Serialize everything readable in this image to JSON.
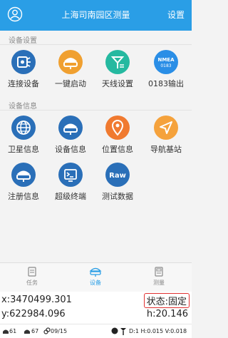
{
  "header": {
    "title": "上海司南园区测量",
    "settings_label": "设置",
    "color": "#2a9ee6"
  },
  "sections": {
    "device_settings": "设备设置",
    "device_info": "设备信息"
  },
  "tiles": [
    {
      "label": "连接设备",
      "icon": "connect-device-icon",
      "color": "#2a6fb8"
    },
    {
      "label": "一键启动",
      "icon": "one-key-start-icon",
      "color": "#f0a030"
    },
    {
      "label": "天线设置",
      "icon": "antenna-icon",
      "color": "#25b9a0"
    },
    {
      "label": "0183输出",
      "icon": "nmea-icon",
      "color": "#2a8ee6",
      "badge_top": "NMEA",
      "badge_bottom": "0183"
    },
    {
      "label": "卫星信息",
      "icon": "satellite-globe-icon",
      "color": "#2a6fb8"
    },
    {
      "label": "设备信息",
      "icon": "device-info-icon",
      "color": "#2a6fb8"
    },
    {
      "label": "位置信息",
      "icon": "location-pin-icon",
      "color": "#f07a30"
    },
    {
      "label": "导航基站",
      "icon": "navigation-arrow-icon",
      "color": "#f5a23c"
    },
    {
      "label": "注册信息",
      "icon": "register-info-icon",
      "color": "#2a6fb8"
    },
    {
      "label": "超级终端",
      "icon": "terminal-icon",
      "color": "#2a6fb8"
    },
    {
      "label": "测试数据",
      "icon": "raw-data-icon",
      "color": "#2a6fb8",
      "badge": "Raw"
    }
  ],
  "tabs": [
    {
      "label": "任务",
      "icon": "task-icon",
      "active": false
    },
    {
      "label": "设备",
      "icon": "device-tab-icon",
      "active": true
    },
    {
      "label": "测量",
      "icon": "measure-icon",
      "active": false
    }
  ],
  "coords": {
    "x": "x:3470499.301",
    "y": "y:622984.096",
    "status": "状态:固定",
    "h": "h:20.146"
  },
  "statusbar": {
    "sat1": "61",
    "sat2": "67",
    "link": "09/15",
    "diff": "D:1 H:0.015 V:0.018"
  }
}
